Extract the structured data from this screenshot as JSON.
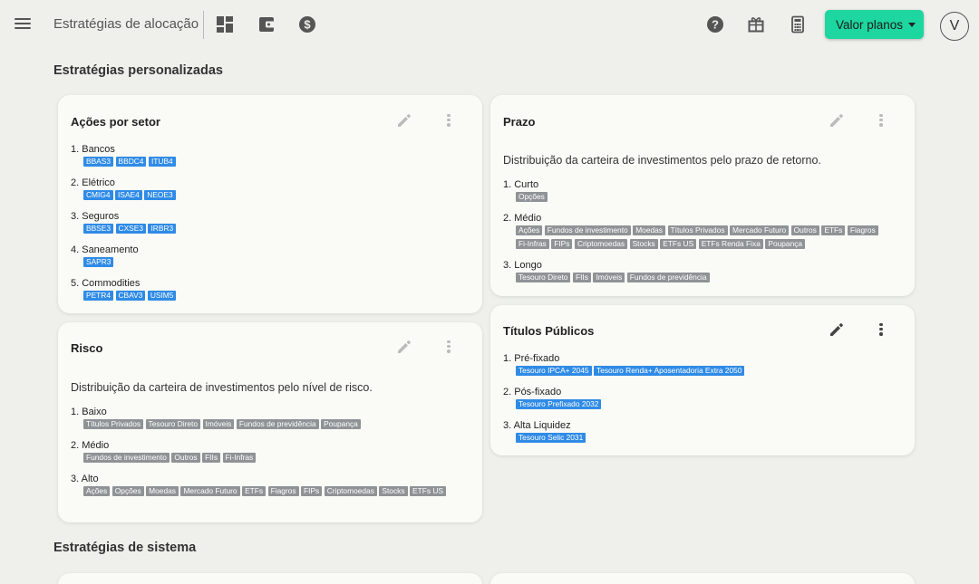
{
  "header": {
    "title": "Estratégias de alocação",
    "cta_label": "Valor planos",
    "avatar_initial": "V",
    "icons": [
      "menu-icon",
      "dashboard-icon",
      "wallet-icon",
      "dollar-icon",
      "help-icon",
      "gift-icon",
      "calculator-icon"
    ]
  },
  "sections": {
    "custom_title": "Estratégias personalizadas",
    "system_title": "Estratégias de sistema"
  },
  "colors": {
    "accent": "#1ed6a0",
    "tag_blue": "#2f8be6",
    "tag_gray": "#8f9396",
    "background": "#eff0ec"
  },
  "cards": {
    "acoes": {
      "title": "Ações por setor",
      "groups": [
        {
          "label": "1. Bancos",
          "tags": [
            "BBAS3",
            "BBDC4",
            "ITUB4"
          ]
        },
        {
          "label": "2. Elétrico",
          "tags": [
            "CMIG4",
            "ISAE4",
            "NEOE3"
          ]
        },
        {
          "label": "3. Seguros",
          "tags": [
            "BBSE3",
            "CXSE3",
            "IRBR3"
          ]
        },
        {
          "label": "4. Saneamento",
          "tags": [
            "SAPR3"
          ]
        },
        {
          "label": "5. Commodities",
          "tags": [
            "PETR4",
            "CBAV3",
            "USIM5"
          ]
        }
      ]
    },
    "prazo": {
      "title": "Prazo",
      "description": "Distribuição da carteira de investimentos pelo prazo de retorno.",
      "groups": [
        {
          "label": "1. Curto",
          "tags": [
            "Opções"
          ]
        },
        {
          "label": "2. Médio",
          "tags": [
            "Ações",
            "Fundos de investimento",
            "Moedas",
            "Títulos Privados",
            "Mercado Futuro",
            "Outros",
            "ETFs",
            "Fiagros",
            "Fi-Infras",
            "FIPs",
            "Criptomoedas",
            "Stocks",
            "ETFs US",
            "ETFs Renda Fixa",
            "Poupança"
          ]
        },
        {
          "label": "3. Longo",
          "tags": [
            "Tesouro Direto",
            "FIIs",
            "Imóveis",
            "Fundos de previdência"
          ]
        }
      ]
    },
    "risco": {
      "title": "Risco",
      "description": "Distribuição da carteira de investimentos pelo nível de risco.",
      "groups": [
        {
          "label": "1. Baixo",
          "tags": [
            "Títulos Privados",
            "Tesouro Direto",
            "Imóveis",
            "Fundos de previdência",
            "Poupança"
          ]
        },
        {
          "label": "2. Médio",
          "tags": [
            "Fundos de investimento",
            "Outros",
            "FIIs",
            "Fi-Infras"
          ]
        },
        {
          "label": "3. Alto",
          "tags": [
            "Ações",
            "Opções",
            "Moedas",
            "Mercado Futuro",
            "ETFs",
            "Fiagros",
            "FIPs",
            "Criptomoedas",
            "Stocks",
            "ETFs US"
          ]
        }
      ]
    },
    "titulos": {
      "title": "Títulos Públicos",
      "groups": [
        {
          "label": "1. Pré-fixado",
          "tags": [
            "Tesouro IPCA+ 2045",
            "Tesouro Renda+ Aposentadoria Extra 2050"
          ]
        },
        {
          "label": "2. Pós-fixado",
          "tags": [
            "Tesouro Prefixado 2032"
          ]
        },
        {
          "label": "3. Alta Liquidez",
          "tags": [
            "Tesouro Selic 2031"
          ]
        }
      ]
    }
  }
}
